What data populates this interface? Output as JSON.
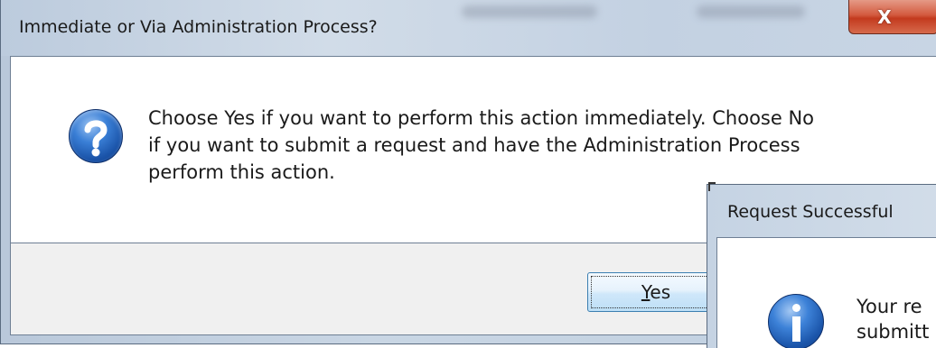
{
  "dialog_main": {
    "title": "Immediate or Via Administration Process?",
    "close_label": "X",
    "message_lines": [
      "Choose Yes if you want to perform this action immediately. Choose No",
      "if you want to submit a request and have the Administration Process",
      "perform this action."
    ],
    "yes_underlined": "Y",
    "yes_rest": "es"
  },
  "dialog_secondary": {
    "title": "Request Successful",
    "message_lines": [
      "Your re",
      "submitt"
    ]
  },
  "colors": {
    "title_bar": "#c9d6e4",
    "close_button": "#c33a1e",
    "content_bg": "#ffffff",
    "footer_bg": "#f0f0f0",
    "button_border": "#3c7fb1",
    "icon_blue": "#1a53a8"
  },
  "icons": {
    "question": "question-icon",
    "info": "info-icon",
    "close": "close-icon"
  }
}
